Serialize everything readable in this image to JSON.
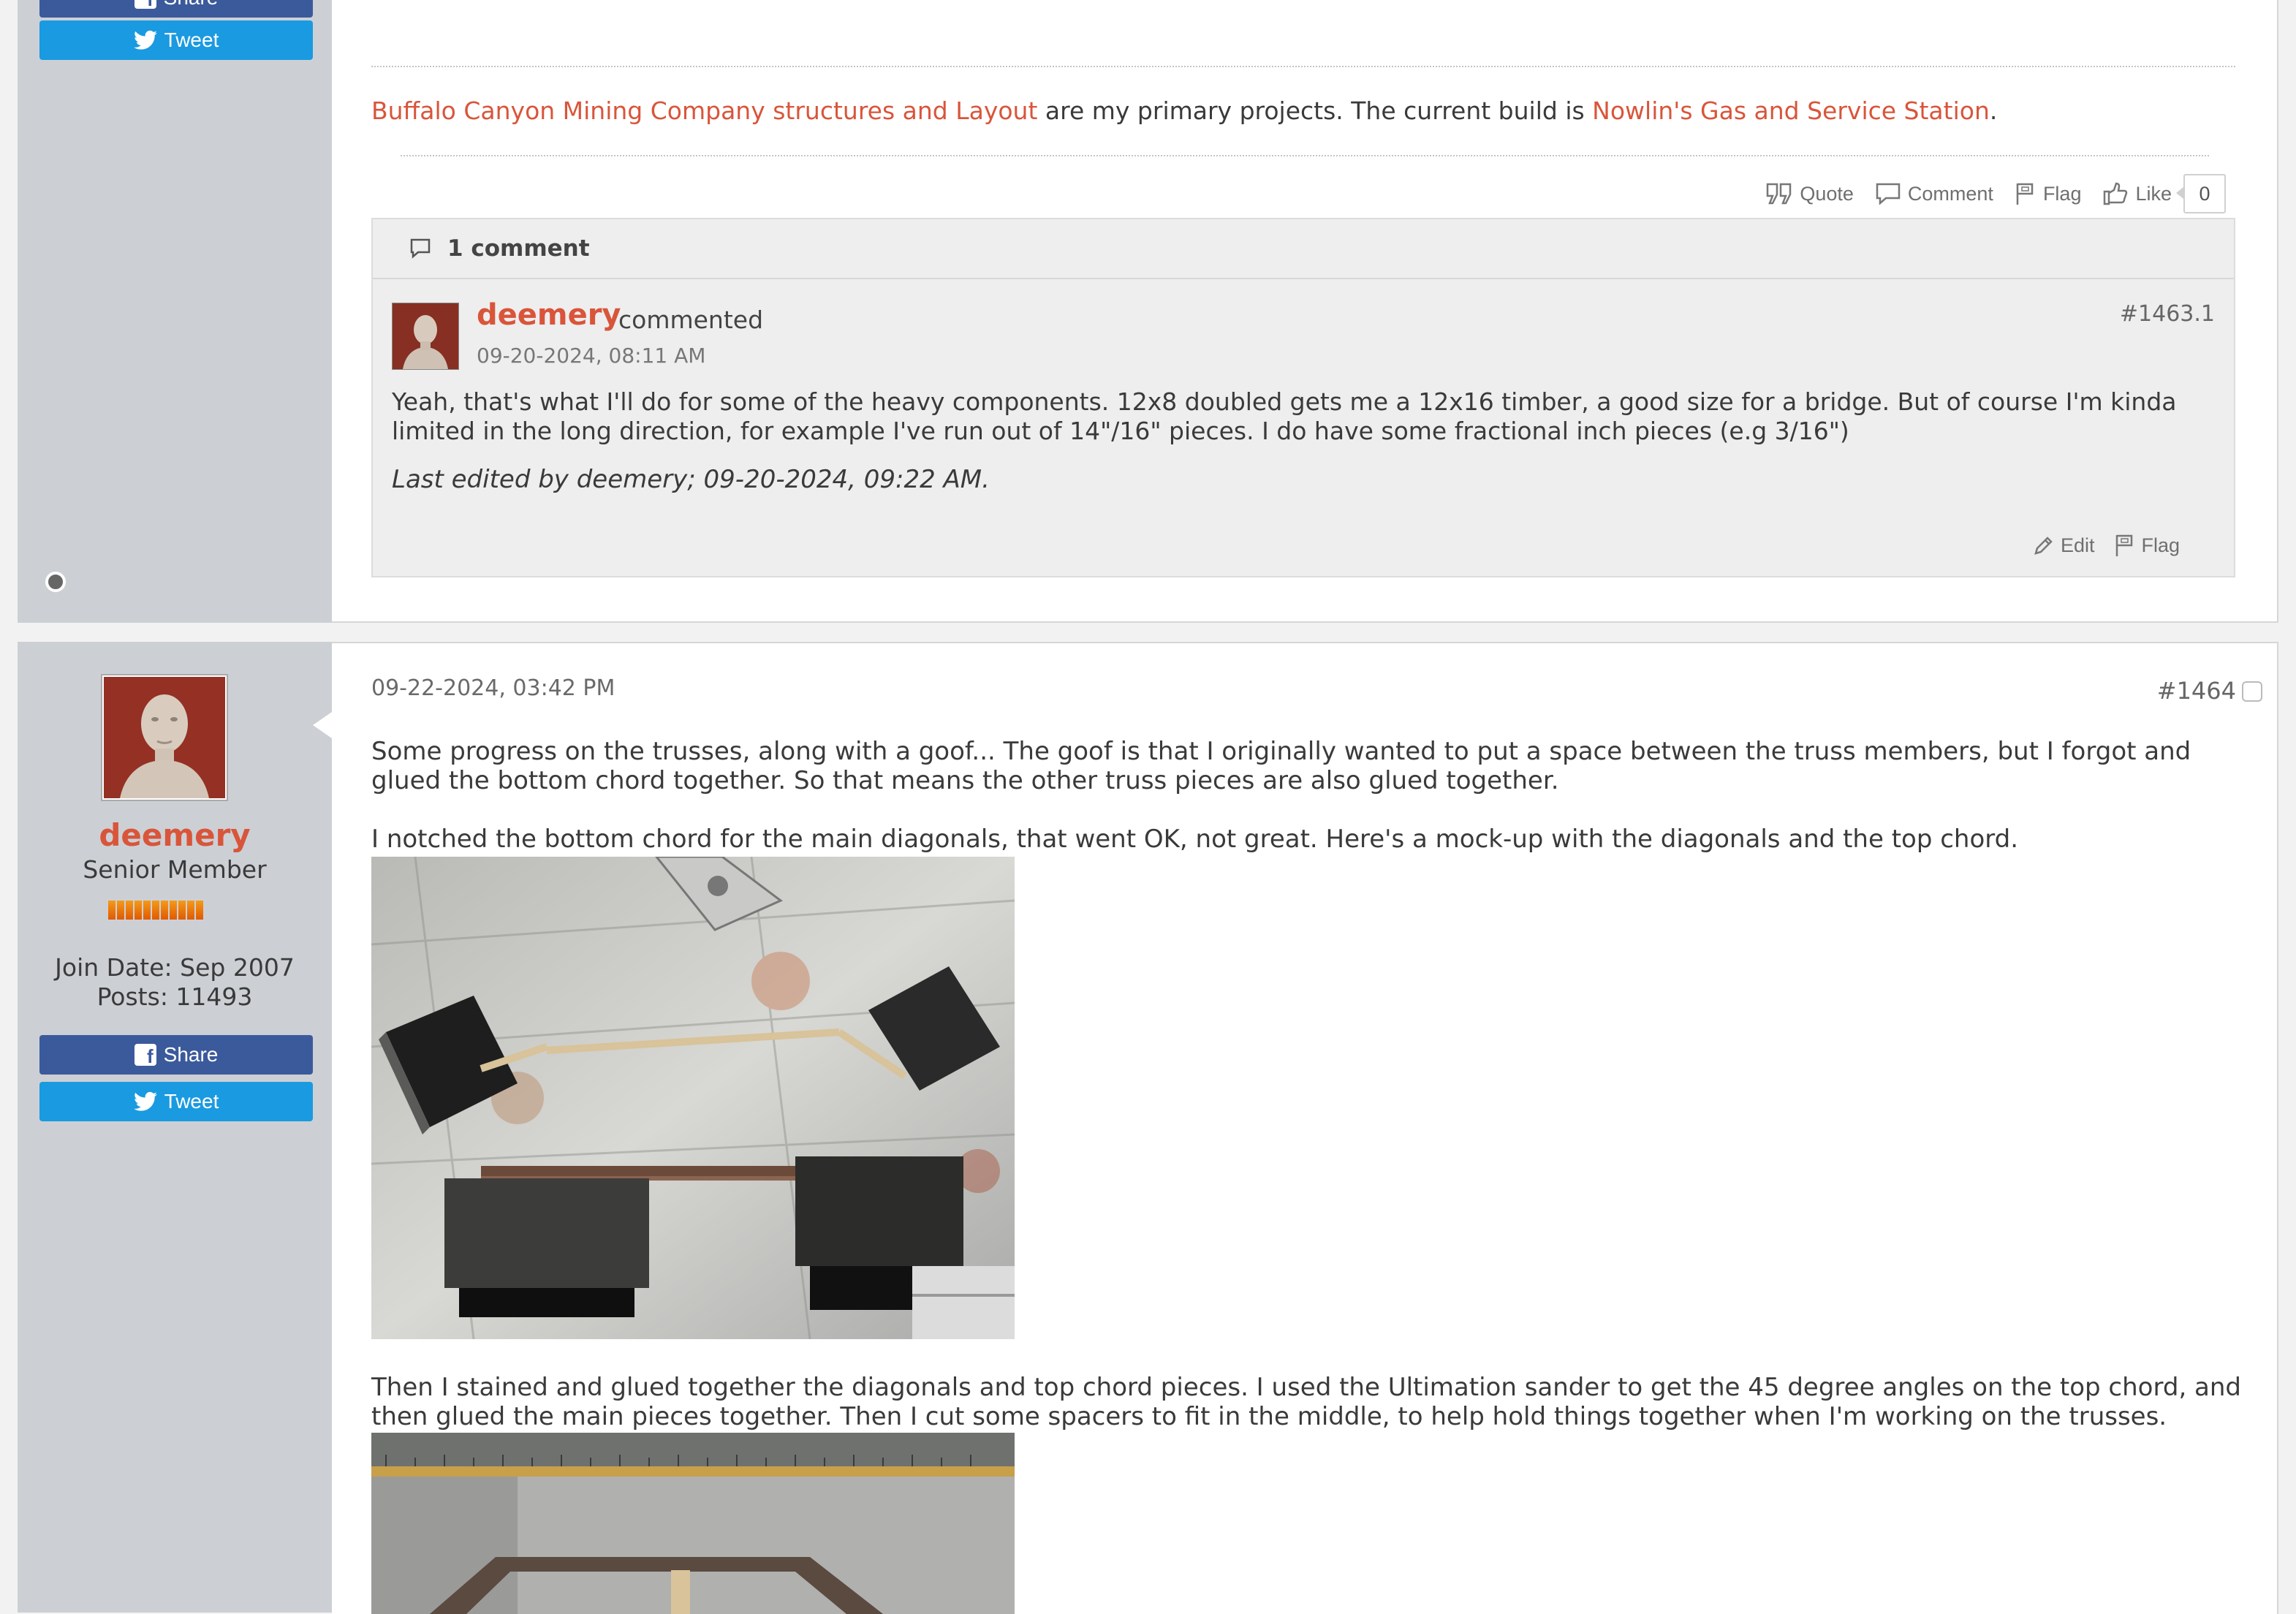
{
  "post1": {
    "sidebar": {
      "share_label": "Share",
      "tweet_label": "Tweet"
    },
    "signature": {
      "link1": "Buffalo Canyon Mining Company structures and Layout",
      "middle": " are my primary projects. The current build is ",
      "link2": "Nowlin's Gas and Service Station",
      "end": "."
    },
    "actions": {
      "quote": "Quote",
      "comment": "Comment",
      "flag": "Flag",
      "like": "Like",
      "like_count": "0"
    },
    "comments": {
      "header": "1 comment",
      "items": [
        {
          "author": "deemery",
          "verb": "commented",
          "date": "09-20-2024, 08:11 AM",
          "number": "#1463.1",
          "text": "Yeah, that's what I'll do for some of the heavy components. 12x8 doubled gets me a 12x16 timber, a good size for a bridge. But of course I'm kinda limited in the long direction, for example I've run out of 14\"/16\" pieces. I do have some fractional inch pieces (e.g 3/16\")",
          "edited": "Last edited by deemery; 09-20-2024, 09:22 AM.",
          "edit_label": "Edit",
          "flag_label": "Flag"
        }
      ]
    }
  },
  "post2": {
    "user": {
      "name": "deemery",
      "title": "Senior Member",
      "reputation_bars": 11,
      "join_date": "Join Date: Sep 2007",
      "posts": "Posts: 11493",
      "share_label": "Share",
      "tweet_label": "Tweet"
    },
    "date": "09-22-2024, 03:42 PM",
    "number": "#1464",
    "paragraphs": [
      "Some progress on the trusses, along with a goof... The goof is that I originally wanted to put a space between the truss members, but I forgot and glued the bottom chord together. So that means the other truss pieces are also glued together.",
      "I notched the bottom chord for the main diagonals, that went OK, not great. Here's a mock-up with the diagonals and the top chord.",
      "Then I stained and glued together the diagonals and top chord pieces. I used the Ultimation sander to get the 45 degree angles on the top chord, and then glued the main pieces together. Then I cut some spacers to fit in the middle, to help hold things together when I'm working on the trusses."
    ]
  },
  "colors": {
    "accent": "#d9553a",
    "facebook": "#3b5a9c",
    "twitter": "#1a9ae0",
    "sidebar": "#ccd0d5"
  }
}
